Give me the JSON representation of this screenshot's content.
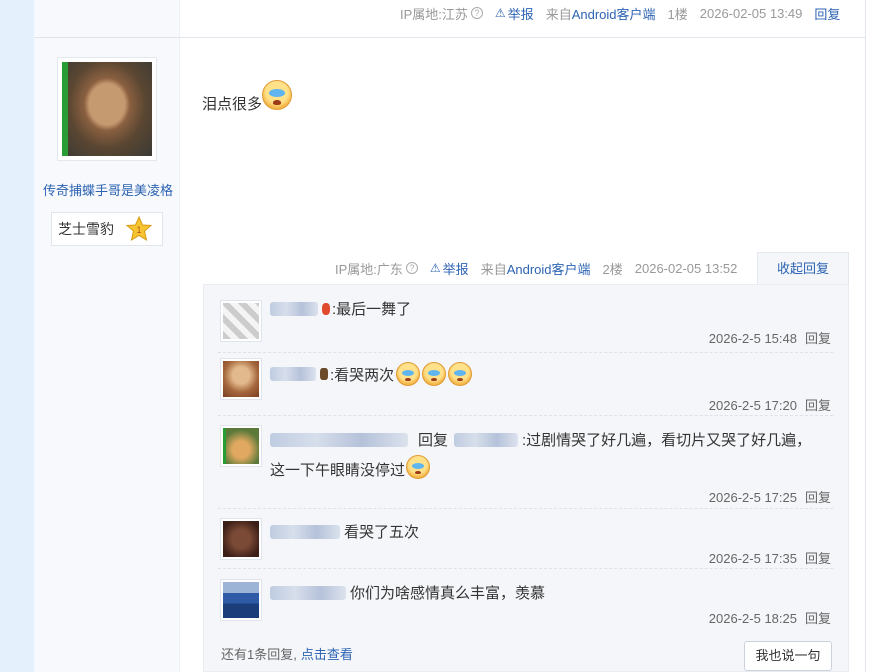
{
  "prev_post_meta": {
    "ip": "IP属地:江苏",
    "report": "举报",
    "source_prefix": "来自",
    "source": "Android客户端",
    "floor": "1楼",
    "time": "2026-02-05 13:49",
    "reply": "回复"
  },
  "author": {
    "name": "传奇捕蝶手哥是美凌格",
    "level_name": "芝士雪豹",
    "level_num": "1"
  },
  "post": {
    "text": "泪点很多",
    "emoji": "cry-emoji"
  },
  "post_meta": {
    "ip": "IP属地:广东",
    "report": "举报",
    "source_prefix": "来自",
    "source": "Android客户端",
    "floor": "2楼",
    "time": "2026-02-05 13:52",
    "collapse": "收起回复"
  },
  "replies": [
    {
      "text": ":最后一舞了",
      "time": "2026-2-5 15:48",
      "reply": "回复"
    },
    {
      "text": ":看哭两次",
      "time": "2026-2-5 17:20",
      "reply": "回复"
    },
    {
      "reply_word": "回复",
      "text": ":过剧情哭了好几遍，看切片又哭了好几遍，",
      "text2": "这一下午眼睛没停过",
      "time": "2026-2-5 17:25",
      "reply": "回复"
    },
    {
      "text": "看哭了五次",
      "time": "2026-2-5 17:35",
      "reply": "回复"
    },
    {
      "text": "你们为啥感情真么丰富，羡慕",
      "time": "2026-2-5 18:25",
      "reply": "回复"
    }
  ],
  "footer": {
    "more_text": "还有1条回复,",
    "more_link": "点击查看",
    "say_button": "我也说一句"
  },
  "colors": {
    "link": "#2d64b3",
    "meta": "#999999",
    "reply_bg": "#f4f6f9"
  }
}
